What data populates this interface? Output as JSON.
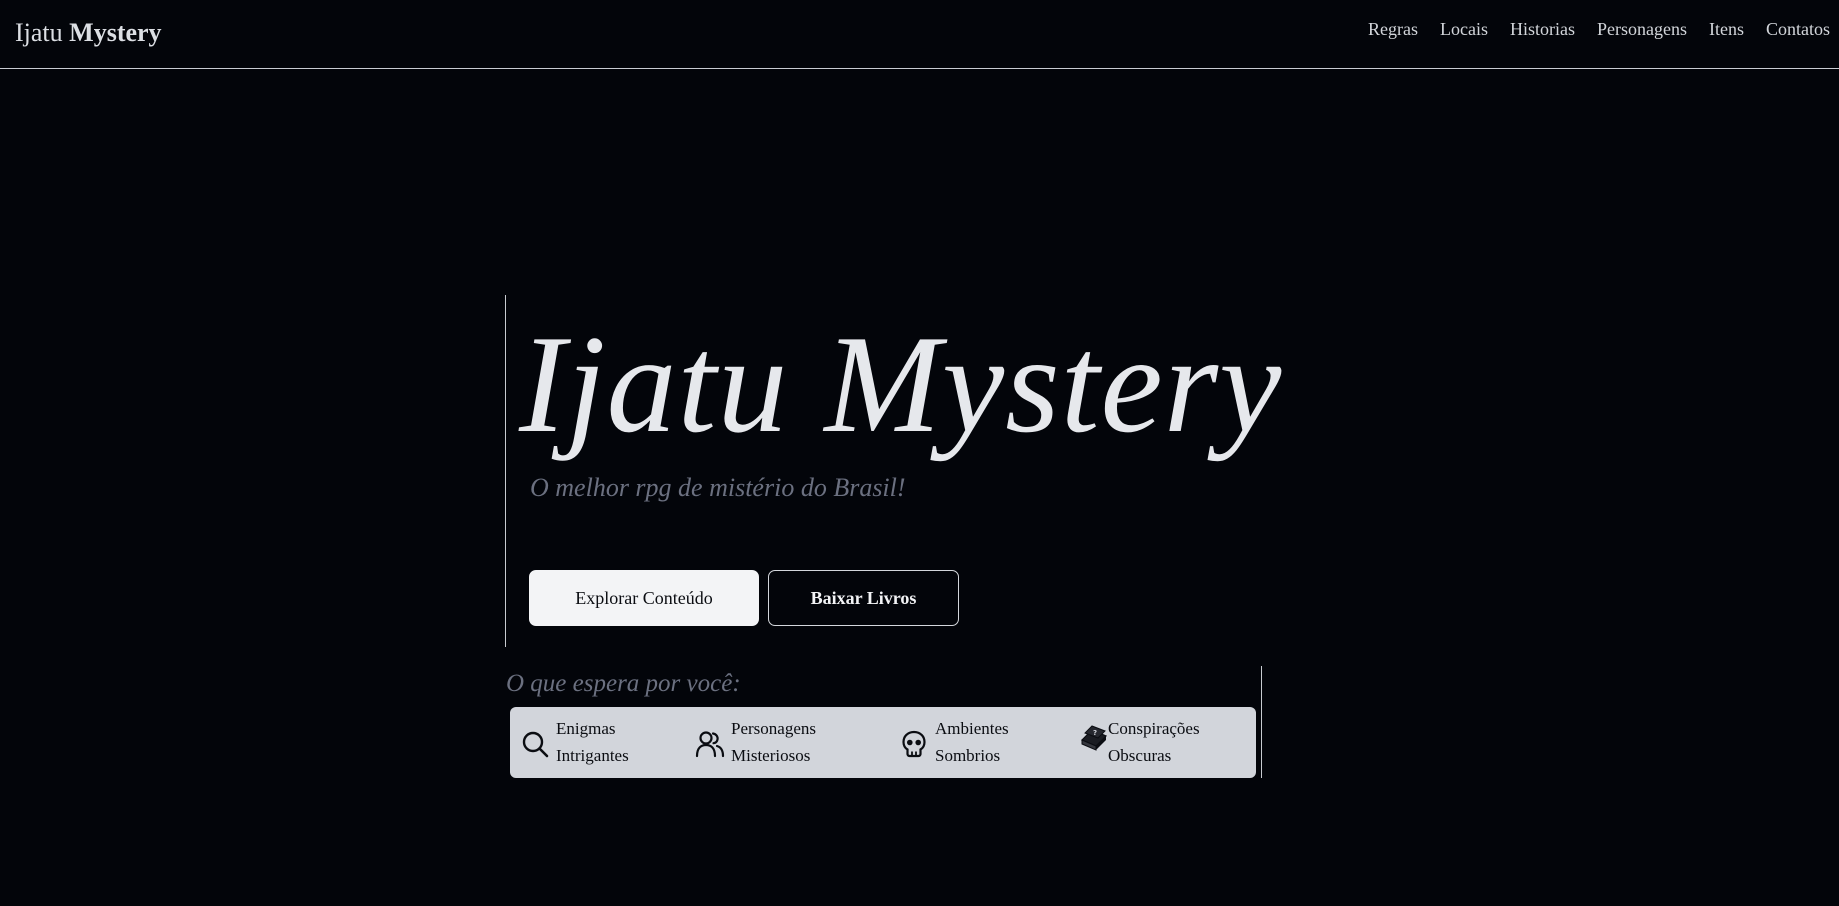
{
  "navbar": {
    "brand_light": "Ijatu",
    "brand_bold": "Mystery",
    "links": [
      "Regras",
      "Locais",
      "Historias",
      "Personagens",
      "Itens",
      "Contatos"
    ]
  },
  "hero": {
    "title": "Ijatu Mystery",
    "subtitle": "O melhor rpg de mistério do Brasil!",
    "primary_button": "Explorar Conteúdo",
    "secondary_button": "Baixar Livros"
  },
  "expect": {
    "title": "O que espera por você:",
    "features": [
      {
        "icon": "search-icon",
        "line1": "Enigmas",
        "line2": "Intrigantes"
      },
      {
        "icon": "users-icon",
        "line1": "Personagens",
        "line2": "Misteriosos"
      },
      {
        "icon": "skull-icon",
        "line1": "Ambientes",
        "line2": "Sombrios"
      },
      {
        "icon": "book-icon",
        "line1": "Conspirações",
        "line2": "Obscuras"
      }
    ]
  },
  "colors": {
    "background": "#03050a",
    "text": "#e6e8ec",
    "muted": "#6b7080",
    "panel": "#d2d5db"
  }
}
